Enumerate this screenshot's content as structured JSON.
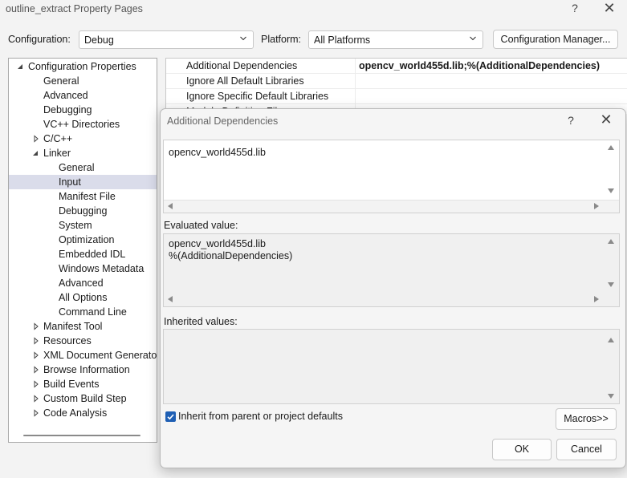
{
  "window": {
    "title": "outline_extract Property Pages",
    "help_glyph": "?",
    "close_glyph": "✕"
  },
  "config_bar": {
    "configuration_label": "Configuration:",
    "configuration_value": "Debug",
    "platform_label": "Platform:",
    "platform_value": "All Platforms",
    "config_manager_label": "Configuration Manager..."
  },
  "tree": {
    "items": [
      {
        "label": "Configuration Properties",
        "level": 0,
        "arrow": "expanded"
      },
      {
        "label": "General",
        "level": 1,
        "arrow": "none"
      },
      {
        "label": "Advanced",
        "level": 1,
        "arrow": "none"
      },
      {
        "label": "Debugging",
        "level": 1,
        "arrow": "none"
      },
      {
        "label": "VC++ Directories",
        "level": 1,
        "arrow": "none"
      },
      {
        "label": "C/C++",
        "level": 1,
        "arrow": "collapsed"
      },
      {
        "label": "Linker",
        "level": 1,
        "arrow": "expanded"
      },
      {
        "label": "General",
        "level": 2,
        "arrow": "none"
      },
      {
        "label": "Input",
        "level": 2,
        "arrow": "none",
        "selected": true
      },
      {
        "label": "Manifest File",
        "level": 2,
        "arrow": "none"
      },
      {
        "label": "Debugging",
        "level": 2,
        "arrow": "none"
      },
      {
        "label": "System",
        "level": 2,
        "arrow": "none"
      },
      {
        "label": "Optimization",
        "level": 2,
        "arrow": "none"
      },
      {
        "label": "Embedded IDL",
        "level": 2,
        "arrow": "none"
      },
      {
        "label": "Windows Metadata",
        "level": 2,
        "arrow": "none"
      },
      {
        "label": "Advanced",
        "level": 2,
        "arrow": "none"
      },
      {
        "label": "All Options",
        "level": 2,
        "arrow": "none"
      },
      {
        "label": "Command Line",
        "level": 2,
        "arrow": "none"
      },
      {
        "label": "Manifest Tool",
        "level": 1,
        "arrow": "collapsed"
      },
      {
        "label": "Resources",
        "level": 1,
        "arrow": "collapsed"
      },
      {
        "label": "XML Document Generator",
        "level": 1,
        "arrow": "collapsed"
      },
      {
        "label": "Browse Information",
        "level": 1,
        "arrow": "collapsed"
      },
      {
        "label": "Build Events",
        "level": 1,
        "arrow": "collapsed"
      },
      {
        "label": "Custom Build Step",
        "level": 1,
        "arrow": "collapsed"
      },
      {
        "label": "Code Analysis",
        "level": 1,
        "arrow": "collapsed"
      }
    ]
  },
  "property_grid": {
    "rows": [
      {
        "name": "Additional Dependencies",
        "value": "opencv_world455d.lib;%(AdditionalDependencies)"
      },
      {
        "name": "Ignore All Default Libraries",
        "value": ""
      },
      {
        "name": "Ignore Specific Default Libraries",
        "value": ""
      },
      {
        "name": "Module Definition File",
        "value": ""
      }
    ]
  },
  "dialog": {
    "title": "Additional Dependencies",
    "help_glyph": "?",
    "close_glyph": "✕",
    "edit_text": "opencv_world455d.lib",
    "evaluated_label": "Evaluated value:",
    "evaluated_lines": [
      "opencv_world455d.lib",
      "%(AdditionalDependencies)"
    ],
    "inherited_label": "Inherited values:",
    "inherit_checkbox_label": "Inherit from parent or project defaults",
    "inherit_checked": true,
    "macros_label": "Macros>>",
    "ok_label": "OK",
    "cancel_label": "Cancel"
  },
  "colors": {
    "selection": "#dadcea",
    "checkbox": "#1f5fb4"
  }
}
